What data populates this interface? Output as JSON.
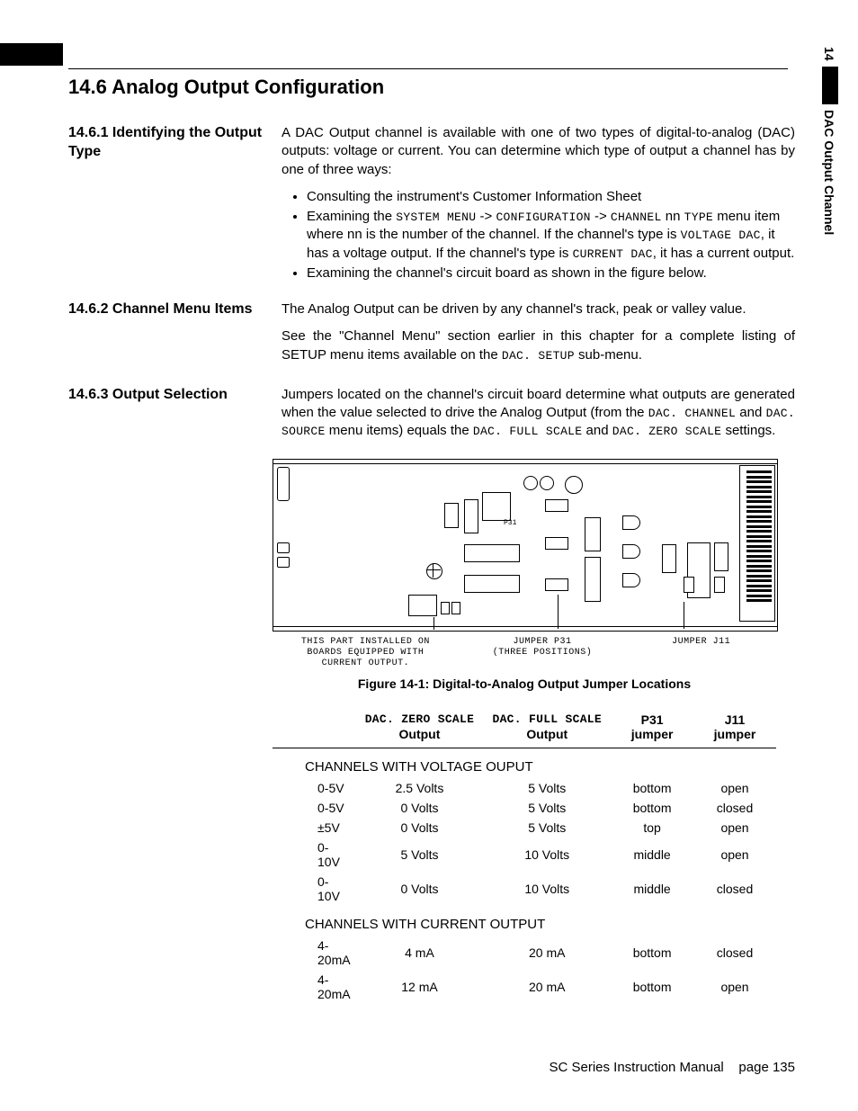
{
  "sideTab": {
    "num": "14",
    "label": "DAC Output Channel"
  },
  "sectionTitle": "14.6  Analog Output Configuration",
  "sub1": {
    "head": "14.6.1 Identifying the Output Type",
    "p1": "A DAC Output channel is available with one of two types of digital-to-analog (DAC) outputs: voltage or current.  You can determine which type of output a channel has by one of three ways:",
    "b1": "Consulting the instrument's Customer Information Sheet",
    "b2a": "Examining the ",
    "b2_m1": "SYSTEM MENU",
    "b2b": " -> ",
    "b2_m2": "CONFIGURATION",
    "b2c": " -> ",
    "b2_m3": "CHANNEL",
    "b2d": " nn ",
    "b2_m4": "TYPE",
    "b2e": " menu item where nn is the number of the channel. If the channel's type is ",
    "b2_m5": "VOLTAGE DAC",
    "b2f": ", it has a voltage output. If the channel's type is ",
    "b2_m6": "CURRENT DAC",
    "b2g": ", it has a current output.",
    "b3": "Examining the channel's circuit board as shown in the figure below."
  },
  "sub2": {
    "head": "14.6.2 Channel Menu Items",
    "p1": "The Analog Output can be driven by any channel's track, peak or valley value.",
    "p2a": "See the \"Channel Menu\" section earlier in this chapter for a complete listing of SETUP menu items available on the ",
    "p2_m1": "DAC. SETUP",
    "p2b": " sub-menu."
  },
  "sub3": {
    "head": "14.6.3 Output Selection",
    "p1a": "Jumpers located on the channel's circuit board determine what outputs are generated when the value selected to drive the Analog Output (from the ",
    "p1_m1": "DAC. CHANNEL",
    "p1b": " and ",
    "p1_m2": "DAC. SOURCE",
    "p1c": " menu items) equals the ",
    "p1_m3": "DAC. FULL SCALE",
    "p1d": " and ",
    "p1_m4": "DAC. ZERO SCALE",
    "p1e": " settings."
  },
  "figure": {
    "c1": "THIS PART INSTALLED ON\nBOARDS EQUIPPED WITH\nCURRENT OUTPUT.",
    "c2": "JUMPER P31\n(THREE POSITIONS)",
    "c3": "JUMPER J11",
    "caption": "Figure 14-1: Digital-to-Analog Output Jumper Locations"
  },
  "table": {
    "h1_m": "DAC. ZERO SCALE",
    "h1": "Output",
    "h2_m": "DAC. FULL SCALE",
    "h2": "Output",
    "h3a": "P31",
    "h3b": "jumper",
    "h4a": "J11",
    "h4b": "jumper",
    "g1": "CHANNELS WITH VOLTAGE OUPUT",
    "g2": "CHANNELS WITH CURRENT OUTPUT",
    "rows_v": [
      {
        "r": "0-5V",
        "zs": "2.5 Volts",
        "fs": "5 Volts",
        "p31": "bottom",
        "j11": "open"
      },
      {
        "r": "0-5V",
        "zs": "0 Volts",
        "fs": "5 Volts",
        "p31": "bottom",
        "j11": "closed"
      },
      {
        "r": "±5V",
        "zs": "0 Volts",
        "fs": "5 Volts",
        "p31": "top",
        "j11": "open"
      },
      {
        "r": "0-10V",
        "zs": "5 Volts",
        "fs": "10 Volts",
        "p31": "middle",
        "j11": "open"
      },
      {
        "r": "0-10V",
        "zs": "0 Volts",
        "fs": "10 Volts",
        "p31": "middle",
        "j11": "closed"
      }
    ],
    "rows_c": [
      {
        "r": "4-20mA",
        "zs": "4 mA",
        "fs": "20 mA",
        "p31": "bottom",
        "j11": "closed"
      },
      {
        "r": "4-20mA",
        "zs": "12 mA",
        "fs": "20 mA",
        "p31": "bottom",
        "j11": "open"
      }
    ]
  },
  "footer": {
    "manual": "SC Series Instruction Manual",
    "page": "page 135"
  }
}
